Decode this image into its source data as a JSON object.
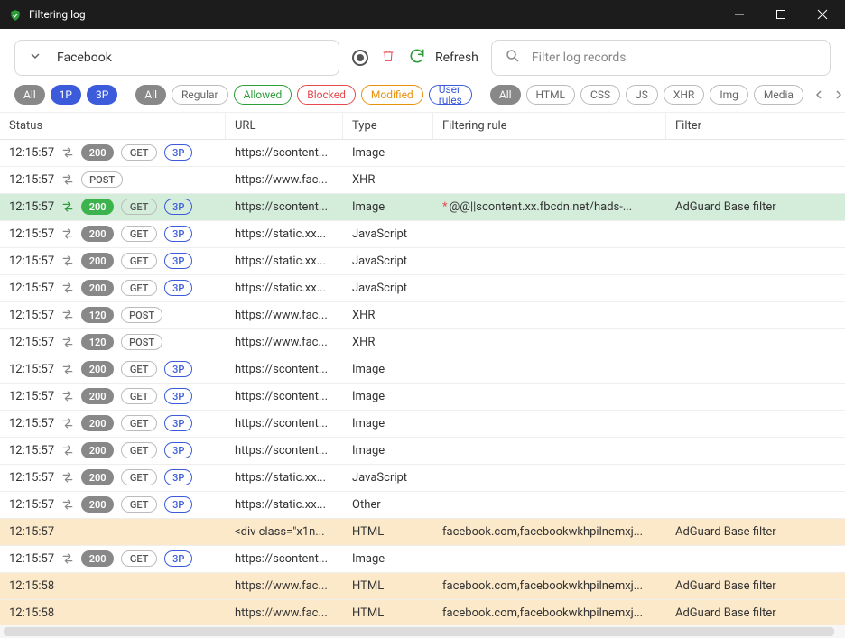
{
  "window": {
    "title": "Filtering log"
  },
  "toolbar": {
    "tab_label": "Facebook",
    "refresh_label": "Refresh",
    "search_placeholder": "Filter log records"
  },
  "chips": {
    "group1": [
      {
        "label": "All",
        "cls": "solid-gray"
      },
      {
        "label": "1P",
        "cls": "solid-blue"
      },
      {
        "label": "3P",
        "cls": "solid-blue"
      }
    ],
    "group2": [
      {
        "label": "All",
        "cls": "solid-gray"
      },
      {
        "label": "Regular",
        "cls": "out-gray"
      },
      {
        "label": "Allowed",
        "cls": "out-green"
      },
      {
        "label": "Blocked",
        "cls": "out-red"
      },
      {
        "label": "Modified",
        "cls": "out-orange"
      },
      {
        "label": "User rules",
        "cls": "out-blue"
      }
    ],
    "group3": [
      {
        "label": "All",
        "cls": "solid-gray"
      },
      {
        "label": "HTML",
        "cls": "out-gray"
      },
      {
        "label": "CSS",
        "cls": "out-gray"
      },
      {
        "label": "JS",
        "cls": "out-gray"
      },
      {
        "label": "XHR",
        "cls": "out-gray"
      },
      {
        "label": "Img",
        "cls": "out-gray"
      },
      {
        "label": "Media",
        "cls": "out-gray"
      }
    ]
  },
  "columns": {
    "status": "Status",
    "url": "URL",
    "type": "Type",
    "rule": "Filtering rule",
    "filter": "Filter"
  },
  "rows": [
    {
      "time": "12:15:57",
      "arrows": "gray",
      "code": "200",
      "method": "GET",
      "party": "3P",
      "url": "https://scontent...",
      "type": "Image",
      "rule": "",
      "filter": "",
      "cls": ""
    },
    {
      "time": "12:15:57",
      "arrows": "gray",
      "code": "",
      "method": "POST",
      "party": "",
      "url": "https://www.fac...",
      "type": "XHR",
      "rule": "",
      "filter": "",
      "cls": ""
    },
    {
      "time": "12:15:57",
      "arrows": "green",
      "code": "200",
      "codecls": "green",
      "method": "GET",
      "party": "3P",
      "url": "https://scontent...",
      "type": "Image",
      "rule": "@@||scontent.xx.fbcdn.net/hads-...",
      "rulestar": true,
      "filter": "AdGuard Base filter",
      "cls": "allowed"
    },
    {
      "time": "12:15:57",
      "arrows": "gray",
      "code": "200",
      "method": "GET",
      "party": "3P",
      "url": "https://static.xx...",
      "type": "JavaScript",
      "rule": "",
      "filter": "",
      "cls": ""
    },
    {
      "time": "12:15:57",
      "arrows": "gray",
      "code": "200",
      "method": "GET",
      "party": "3P",
      "url": "https://static.xx...",
      "type": "JavaScript",
      "rule": "",
      "filter": "",
      "cls": ""
    },
    {
      "time": "12:15:57",
      "arrows": "gray",
      "code": "200",
      "method": "GET",
      "party": "3P",
      "url": "https://static.xx...",
      "type": "JavaScript",
      "rule": "",
      "filter": "",
      "cls": ""
    },
    {
      "time": "12:15:57",
      "arrows": "gray",
      "code": "120",
      "method": "POST",
      "party": "",
      "url": "https://www.fac...",
      "type": "XHR",
      "rule": "",
      "filter": "",
      "cls": ""
    },
    {
      "time": "12:15:57",
      "arrows": "gray",
      "code": "120",
      "method": "POST",
      "party": "",
      "url": "https://www.fac...",
      "type": "XHR",
      "rule": "",
      "filter": "",
      "cls": ""
    },
    {
      "time": "12:15:57",
      "arrows": "gray",
      "code": "200",
      "method": "GET",
      "party": "3P",
      "url": "https://scontent...",
      "type": "Image",
      "rule": "",
      "filter": "",
      "cls": ""
    },
    {
      "time": "12:15:57",
      "arrows": "gray",
      "code": "200",
      "method": "GET",
      "party": "3P",
      "url": "https://scontent...",
      "type": "Image",
      "rule": "",
      "filter": "",
      "cls": ""
    },
    {
      "time": "12:15:57",
      "arrows": "gray",
      "code": "200",
      "method": "GET",
      "party": "3P",
      "url": "https://scontent...",
      "type": "Image",
      "rule": "",
      "filter": "",
      "cls": ""
    },
    {
      "time": "12:15:57",
      "arrows": "gray",
      "code": "200",
      "method": "GET",
      "party": "3P",
      "url": "https://scontent...",
      "type": "Image",
      "rule": "",
      "filter": "",
      "cls": ""
    },
    {
      "time": "12:15:57",
      "arrows": "gray",
      "code": "200",
      "method": "GET",
      "party": "3P",
      "url": "https://static.xx...",
      "type": "JavaScript",
      "rule": "",
      "filter": "",
      "cls": ""
    },
    {
      "time": "12:15:57",
      "arrows": "gray",
      "code": "200",
      "method": "GET",
      "party": "3P",
      "url": "https://static.xx...",
      "type": "Other",
      "rule": "",
      "filter": "",
      "cls": ""
    },
    {
      "time": "12:15:57",
      "arrows": "",
      "code": "",
      "method": "",
      "party": "",
      "url": "<div class=\"x1n...",
      "type": "HTML",
      "rule": "facebook.com,facebookwkhpilnemxj...",
      "filter": "AdGuard Base filter",
      "cls": "modified"
    },
    {
      "time": "12:15:57",
      "arrows": "gray",
      "code": "200",
      "method": "GET",
      "party": "3P",
      "url": "https://scontent...",
      "type": "Image",
      "rule": "",
      "filter": "",
      "cls": ""
    },
    {
      "time": "12:15:58",
      "arrows": "",
      "code": "",
      "method": "",
      "party": "",
      "url": "https://www.fac...",
      "type": "HTML",
      "rule": "facebook.com,facebookwkhpilnemxj...",
      "filter": "AdGuard Base filter",
      "cls": "modified"
    },
    {
      "time": "12:15:58",
      "arrows": "",
      "code": "",
      "method": "",
      "party": "",
      "url": "https://www.fac...",
      "type": "HTML",
      "rule": "facebook.com,facebookwkhpilnemxj...",
      "filter": "AdGuard Base filter",
      "cls": "modified"
    }
  ]
}
